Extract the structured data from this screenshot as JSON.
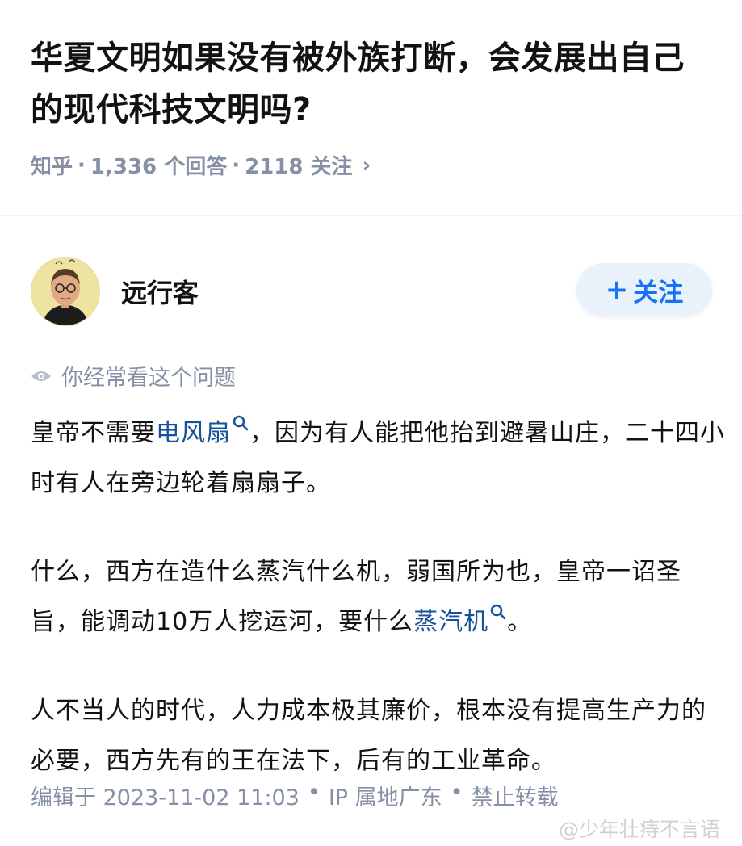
{
  "question": {
    "title": "华夏文明如果没有被外族打断，会发展出自己的现代科技文明吗?",
    "source": "知乎",
    "answers": "1,336 个回答",
    "followers": "2118 关注",
    "chevron": "›"
  },
  "author": {
    "name": "远行客",
    "follow_label": "关注",
    "follow_plus": "+"
  },
  "notice": "你经常看这个问题",
  "content": {
    "p1_a": "皇帝不需要",
    "p1_link": "电风扇",
    "p1_b": "，因为有人能把他抬到避暑山庄，二十四小时有人在旁边轮着扇扇子。",
    "p2_a": "什么，西方在造什么蒸汽什么机，弱国所为也，皇帝一诏圣旨，能调动10万人挖运河，要什么",
    "p2_link": "蒸汽机",
    "p2_b": "。",
    "p3": "人不当人的时代，人力成本极其廉价，根本没有提高生产力的必要，西方先有的王在法下，后有的工业革命。"
  },
  "footer": {
    "edited": "编辑于 2023-11-02 11:03",
    "location": "IP 属地广东",
    "rights": "禁止转载",
    "dot": "•"
  },
  "watermark": "@少年壮痔不言语",
  "colors": {
    "link": "#175199",
    "follow_bg": "#e9f2fb",
    "follow_text": "#1772f6",
    "meta": "#8590a6"
  }
}
